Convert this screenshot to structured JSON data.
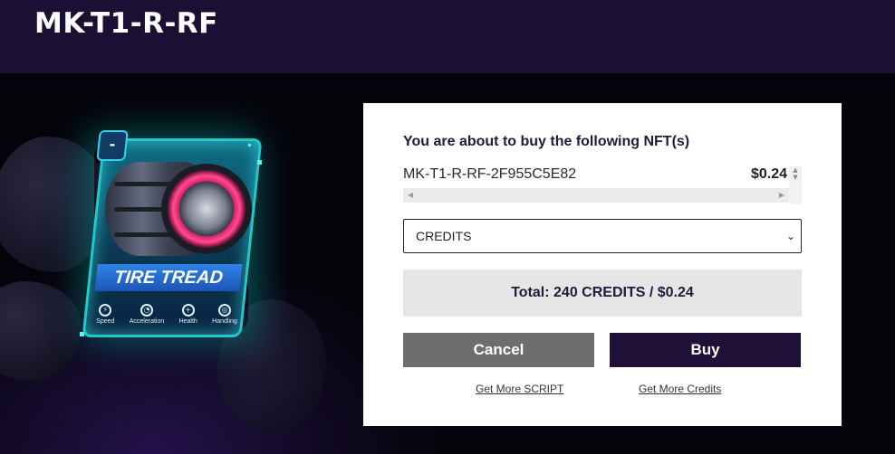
{
  "header": {
    "title": "MK-T1-R-RF"
  },
  "card": {
    "tab_symbol": "-",
    "title": "TIRE TREAD",
    "stats": [
      {
        "icon": "lightning-icon",
        "label": "Speed"
      },
      {
        "icon": "speedometer-icon",
        "label": "Acceleration"
      },
      {
        "icon": "shield-icon",
        "label": "Health"
      },
      {
        "icon": "steering-wheel-icon",
        "label": "Handling"
      }
    ]
  },
  "dialog": {
    "heading": "You are about to buy the following NFT(s)",
    "items": [
      {
        "name": "MK-T1-R-RF-2F955C5E82",
        "price": "$0.24"
      }
    ],
    "currency_select": {
      "selected": "CREDITS"
    },
    "total": "Total: 240 CREDITS / $0.24",
    "cancel_label": "Cancel",
    "buy_label": "Buy",
    "link_script": "Get More SCRIPT",
    "link_credits": "Get More Credits"
  },
  "colors": {
    "header_bg": "#1b0f33",
    "buy_button": "#1e1036",
    "cancel_button": "#6e6e6e",
    "card_accent": "#22c9c9"
  }
}
